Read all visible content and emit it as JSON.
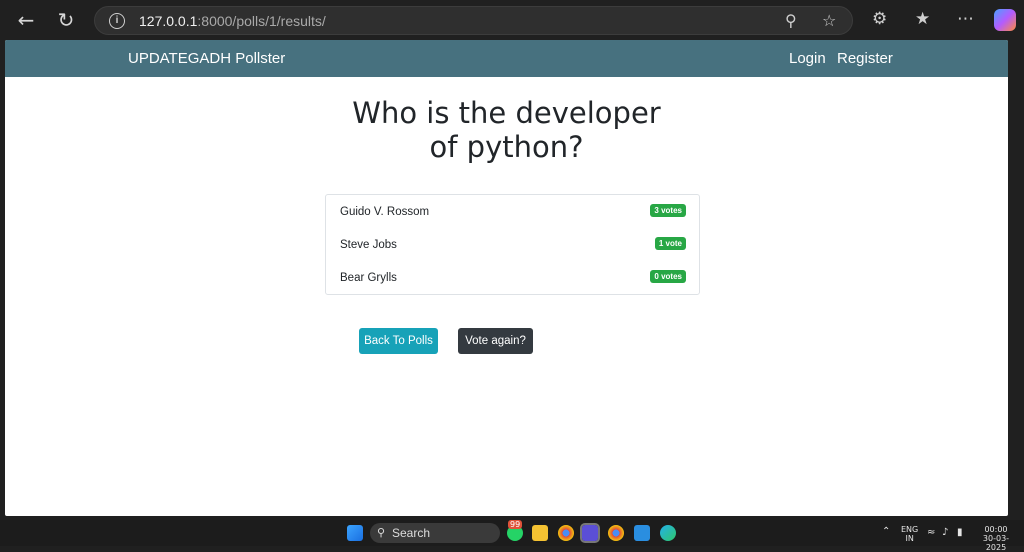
{
  "browser": {
    "url_host": "127.0.0.1",
    "url_rest": ":8000/polls/1/results/"
  },
  "navbar": {
    "brand": "UPDATEGADH Pollster",
    "login": "Login",
    "register": "Register"
  },
  "main": {
    "question": "Who is the developer of python?",
    "choices": [
      {
        "label": "Guido V. Rossom",
        "votes": "3 votes"
      },
      {
        "label": "Steve Jobs",
        "votes": "1 vote"
      },
      {
        "label": "Bear Grylls",
        "votes": "0 votes"
      }
    ],
    "back_button": "Back To Polls",
    "vote_again_button": "Vote again?"
  },
  "taskbar": {
    "search": "Search",
    "whatsapp_badge": "99",
    "lang": "ENG",
    "region": "IN",
    "time": "00:00",
    "date": "30-03-2025"
  },
  "colors": {
    "navbar": "#47717f",
    "badge": "#28a745",
    "back_button": "#17a2b8",
    "vote_button": "#343a40"
  }
}
